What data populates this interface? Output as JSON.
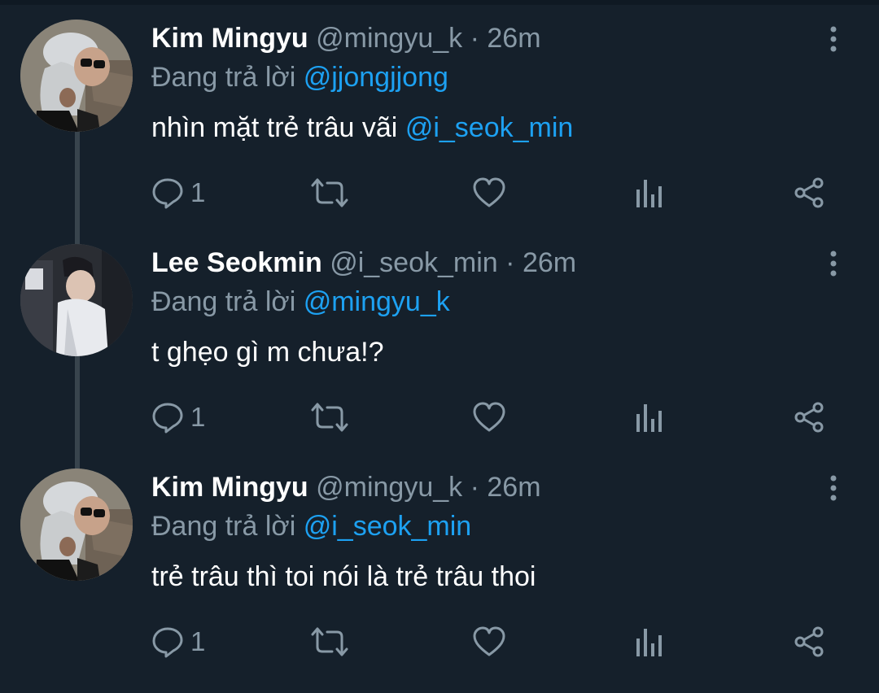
{
  "tweets": [
    {
      "name": "Kim Mingyu",
      "handle": "@mingyu_k",
      "separator": "·",
      "time": "26m",
      "replying_prefix": "Đang trả lời",
      "replying_to": "@jjongjjong",
      "text": "nhìn mặt trẻ trâu vãi ",
      "text_mention": "@i_seok_min",
      "reply_count": "1",
      "avatar_icon": "avatar-photo-mingyu"
    },
    {
      "name": "Lee Seokmin",
      "handle": "@i_seok_min",
      "separator": "·",
      "time": "26m",
      "replying_prefix": "Đang trả lời",
      "replying_to": "@mingyu_k",
      "text": "t ghẹo gì m chưa!?",
      "text_mention": "",
      "reply_count": "1",
      "avatar_icon": "avatar-photo-seokmin"
    },
    {
      "name": "Kim Mingyu",
      "handle": "@mingyu_k",
      "separator": "·",
      "time": "26m",
      "replying_prefix": "Đang trả lời",
      "replying_to": "@i_seok_min",
      "text": "trẻ trâu thì toi nói là trẻ trâu thoi",
      "text_mention": "",
      "reply_count": "1",
      "avatar_icon": "avatar-photo-mingyu"
    }
  ],
  "icons": {
    "reply": "reply-icon",
    "retweet": "retweet-icon",
    "like": "heart-icon",
    "analytics": "analytics-icon",
    "share": "share-icon",
    "more": "more-vertical-icon"
  },
  "colors": {
    "background": "#15202b",
    "text": "#ffffff",
    "secondary": "#8899a6",
    "mention": "#1da1f2",
    "thread_line": "#38444d"
  }
}
